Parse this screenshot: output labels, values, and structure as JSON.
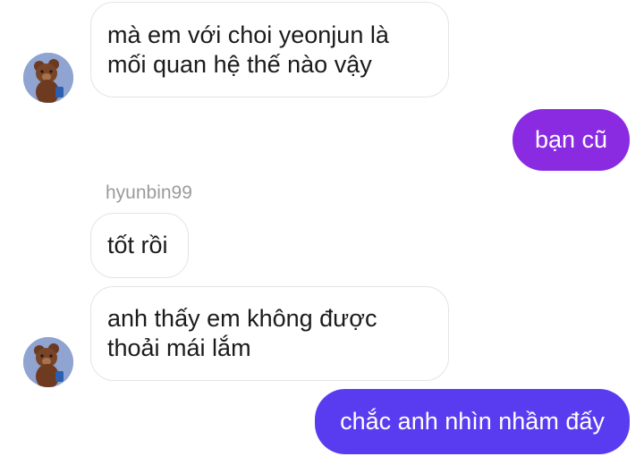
{
  "conversation": {
    "messages": [
      {
        "direction": "incoming",
        "lines": [
          "mà em với choi yeonjun là",
          "mối quan hệ thế nào vậy"
        ]
      },
      {
        "direction": "outgoing",
        "text": "bạn cũ",
        "color": "#8a2be2"
      },
      {
        "direction": "incoming",
        "sender": "hyunbin99",
        "lines": [
          "tốt rồi"
        ]
      },
      {
        "direction": "incoming",
        "lines": [
          "anh thấy em không được",
          "thoải mái lắm"
        ]
      },
      {
        "direction": "outgoing",
        "text": "chắc anh nhìn nhầm đấy",
        "color": "#5a3cf0"
      }
    ]
  },
  "theme": {
    "outgoing_top_color": "#8a2be2",
    "outgoing_bottom_color": "#5a3cf0",
    "incoming_border_color": "#e4e4e6",
    "sender_name_color": "#9b9b9b",
    "avatar_icon": "teddy-bear-icon"
  }
}
